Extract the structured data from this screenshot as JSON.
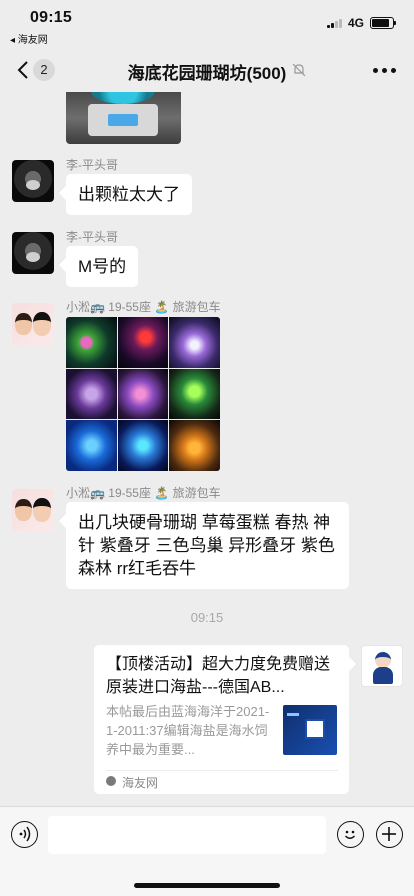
{
  "status_bar": {
    "time": "09:15",
    "back_app": "◂ 海友网",
    "network": "4G",
    "battery_level": 0.85
  },
  "nav": {
    "unread_count": "2",
    "title": "海底花园珊瑚坊(500)",
    "muted": true
  },
  "messages": [
    {
      "sender": "李-平头哥",
      "text": "出颗粒太大了"
    },
    {
      "sender": "李-平头哥",
      "text": "M号的"
    },
    {
      "sender": "小淞🚌 19-55座 🏝️ 旅游包车",
      "type": "image-grid"
    },
    {
      "sender": "小淞🚌 19-55座 🏝️ 旅游包车",
      "text": "出几块硬骨珊瑚 草莓蛋糕 春热 神针 紫叠牙 三色鸟巢 异形叠牙 紫色森林 rr红毛吞牛"
    }
  ],
  "time_divider": "09:15",
  "link_card": {
    "title": "【顶楼活动】超大力度免费赠送原装进口海盐---德国AB...",
    "description": "本帖最后由蓝海海洋于2021-1-2011:37编辑海盐是海水饲养中最为重要...",
    "source": "海友网"
  },
  "input": {
    "placeholder": ""
  },
  "colors": {
    "background": "#ededed",
    "bubble": "#ffffff",
    "meta_text": "#8a8a8a"
  }
}
